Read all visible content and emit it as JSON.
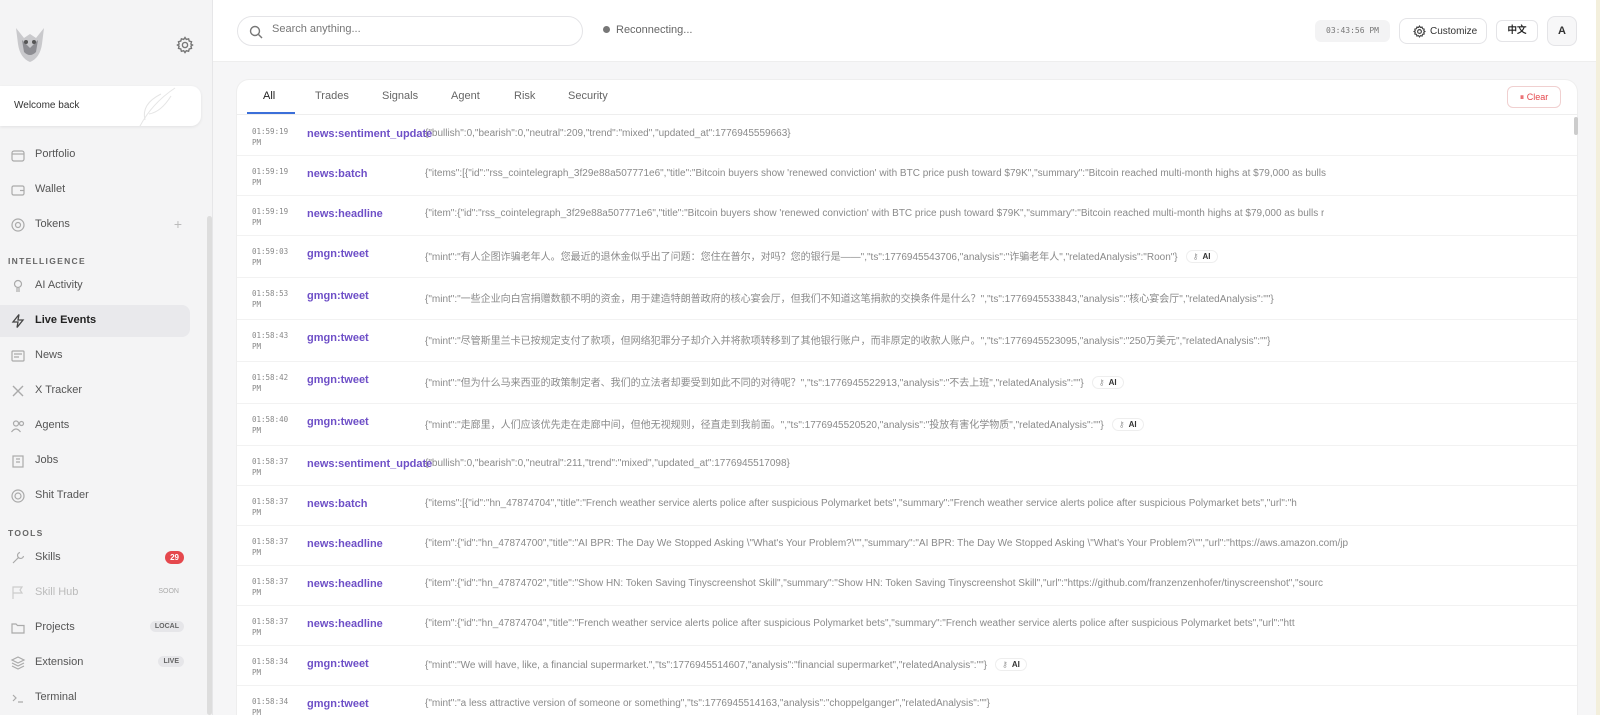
{
  "sidebar": {
    "welcome": "Welcome back",
    "items_top": [
      {
        "label": "Portfolio",
        "icon": "briefcase-icon"
      },
      {
        "label": "Wallet",
        "icon": "wallet-icon"
      },
      {
        "label": "Tokens",
        "icon": "coin-icon"
      }
    ],
    "section_intelligence": "INTELLIGENCE",
    "items_intel": [
      {
        "label": "AI Activity",
        "icon": "bulb-icon"
      },
      {
        "label": "Live Events",
        "icon": "lightning-icon"
      },
      {
        "label": "News",
        "icon": "newspaper-icon"
      },
      {
        "label": "X Tracker",
        "icon": "x-logo-icon"
      },
      {
        "label": "Agents",
        "icon": "users-icon"
      },
      {
        "label": "Jobs",
        "icon": "building-icon"
      },
      {
        "label": "Shit Trader",
        "icon": "target-icon"
      }
    ],
    "section_tools": "TOOLS",
    "items_tools": [
      {
        "label": "Skills",
        "icon": "wrench-icon",
        "badge": "29"
      },
      {
        "label": "Skill Hub",
        "icon": "flag-icon",
        "badge": "SOON"
      },
      {
        "label": "Projects",
        "icon": "folder-icon",
        "badge": "LOCAL"
      },
      {
        "label": "Extension",
        "icon": "layers-icon",
        "badge": "LIVE"
      },
      {
        "label": "Terminal",
        "icon": "terminal-icon"
      }
    ]
  },
  "topbar": {
    "search_placeholder": "Search anything...",
    "status": "Reconnecting...",
    "clock": "03:43:56 PM",
    "customize": "Customize",
    "lang": "中文",
    "avatar": "A"
  },
  "tabs": [
    "All",
    "Trades",
    "Signals",
    "Agent",
    "Risk",
    "Security"
  ],
  "clear_label": "Clear",
  "events": [
    {
      "time": "01:59:19",
      "ampm": "PM",
      "type": "news:sentiment_update",
      "payload": "{\"bullish\":0,\"bearish\":0,\"neutral\":209,\"trend\":\"mixed\",\"updated_at\":1776945559663}",
      "ai": false
    },
    {
      "time": "01:59:19",
      "ampm": "PM",
      "type": "news:batch",
      "payload": "{\"items\":[{\"id\":\"rss_cointelegraph_3f29e88a507771e6\",\"title\":\"Bitcoin buyers show 'renewed conviction' with BTC price push toward $79K\",\"summary\":\"Bitcoin reached multi-month highs at $79,000 as bulls",
      "ai": false
    },
    {
      "time": "01:59:19",
      "ampm": "PM",
      "type": "news:headline",
      "payload": "{\"item\":{\"id\":\"rss_cointelegraph_3f29e88a507771e6\",\"title\":\"Bitcoin buyers show 'renewed conviction' with BTC price push toward $79K\",\"summary\":\"Bitcoin reached multi-month highs at $79,000 as bulls r",
      "ai": false
    },
    {
      "time": "01:59:03",
      "ampm": "PM",
      "type": "gmgn:tweet",
      "payload": "{\"mint\":\"有人企图诈骗老年人。您最近的退休金似乎出了问题：您住在普尔，对吗？您的银行是——\",\"ts\":1776945543706,\"analysis\":\"诈骗老年人\",\"relatedAnalysis\":\"Roon\"}",
      "ai": true
    },
    {
      "time": "01:58:53",
      "ampm": "PM",
      "type": "gmgn:tweet",
      "payload": "{\"mint\":\"一些企业向白宫捐赠数额不明的资金，用于建造特朗普政府的核心宴会厅，但我们不知道这笔捐款的交换条件是什么？\",\"ts\":1776945533843,\"analysis\":\"核心宴会厅\",\"relatedAnalysis\":\"\"}",
      "ai": false
    },
    {
      "time": "01:58:43",
      "ampm": "PM",
      "type": "gmgn:tweet",
      "payload": "{\"mint\":\"尽管斯里兰卡已按规定支付了款项，但网络犯罪分子却介入并将款项转移到了其他银行账户，而非原定的收款人账户。\",\"ts\":1776945523095,\"analysis\":\"250万美元\",\"relatedAnalysis\":\"\"}",
      "ai": false
    },
    {
      "time": "01:58:42",
      "ampm": "PM",
      "type": "gmgn:tweet",
      "payload": "{\"mint\":\"但为什么马来西亚的政策制定者、我们的立法者却要受到如此不同的对待呢？\",\"ts\":1776945522913,\"analysis\":\"不去上班\",\"relatedAnalysis\":\"\"}",
      "ai": true
    },
    {
      "time": "01:58:40",
      "ampm": "PM",
      "type": "gmgn:tweet",
      "payload": "{\"mint\":\"走廊里，人们应该优先走在走廊中间，但他无视规则，径直走到我前面。\",\"ts\":1776945520520,\"analysis\":\"投放有害化学物质\",\"relatedAnalysis\":\"\"}",
      "ai": true
    },
    {
      "time": "01:58:37",
      "ampm": "PM",
      "type": "news:sentiment_update",
      "payload": "{\"bullish\":0,\"bearish\":0,\"neutral\":211,\"trend\":\"mixed\",\"updated_at\":1776945517098}",
      "ai": false
    },
    {
      "time": "01:58:37",
      "ampm": "PM",
      "type": "news:batch",
      "payload": "{\"items\":[{\"id\":\"hn_47874704\",\"title\":\"French weather service alerts police after suspicious Polymarket bets\",\"summary\":\"French weather service alerts police after suspicious Polymarket bets\",\"url\":\"h",
      "ai": false
    },
    {
      "time": "01:58:37",
      "ampm": "PM",
      "type": "news:headline",
      "payload": "{\"item\":{\"id\":\"hn_47874700\",\"title\":\"AI BPR: The Day We Stopped Asking \\\"What's Your Problem?\\\"\",\"summary\":\"AI BPR: The Day We Stopped Asking \\\"What's Your Problem?\\\"\",\"url\":\"https://aws.amazon.com/jp",
      "ai": false
    },
    {
      "time": "01:58:37",
      "ampm": "PM",
      "type": "news:headline",
      "payload": "{\"item\":{\"id\":\"hn_47874702\",\"title\":\"Show HN: Token Saving Tinyscreenshot Skill\",\"summary\":\"Show HN: Token Saving Tinyscreenshot Skill\",\"url\":\"https://github.com/franzenzenhofer/tinyscreenshot\",\"sourc",
      "ai": false
    },
    {
      "time": "01:58:37",
      "ampm": "PM",
      "type": "news:headline",
      "payload": "{\"item\":{\"id\":\"hn_47874704\",\"title\":\"French weather service alerts police after suspicious Polymarket bets\",\"summary\":\"French weather service alerts police after suspicious Polymarket bets\",\"url\":\"htt",
      "ai": false
    },
    {
      "time": "01:58:34",
      "ampm": "PM",
      "type": "gmgn:tweet",
      "payload": "{\"mint\":\"We will have, like, a financial supermarket.\",\"ts\":1776945514607,\"analysis\":\"financial supermarket\",\"relatedAnalysis\":\"\"}",
      "ai": true
    },
    {
      "time": "01:58:34",
      "ampm": "PM",
      "type": "gmgn:tweet",
      "payload": "{\"mint\":\"a less attractive version of someone or something\",\"ts\":1776945514163,\"analysis\":\"choppelganger\",\"relatedAnalysis\":\"\"}",
      "ai": false
    }
  ],
  "ai_label": "AI",
  "colors": {
    "event_type": "#6e4fc7",
    "accent_tab": "#3b6fd9",
    "badge_red": "#e5484d"
  }
}
